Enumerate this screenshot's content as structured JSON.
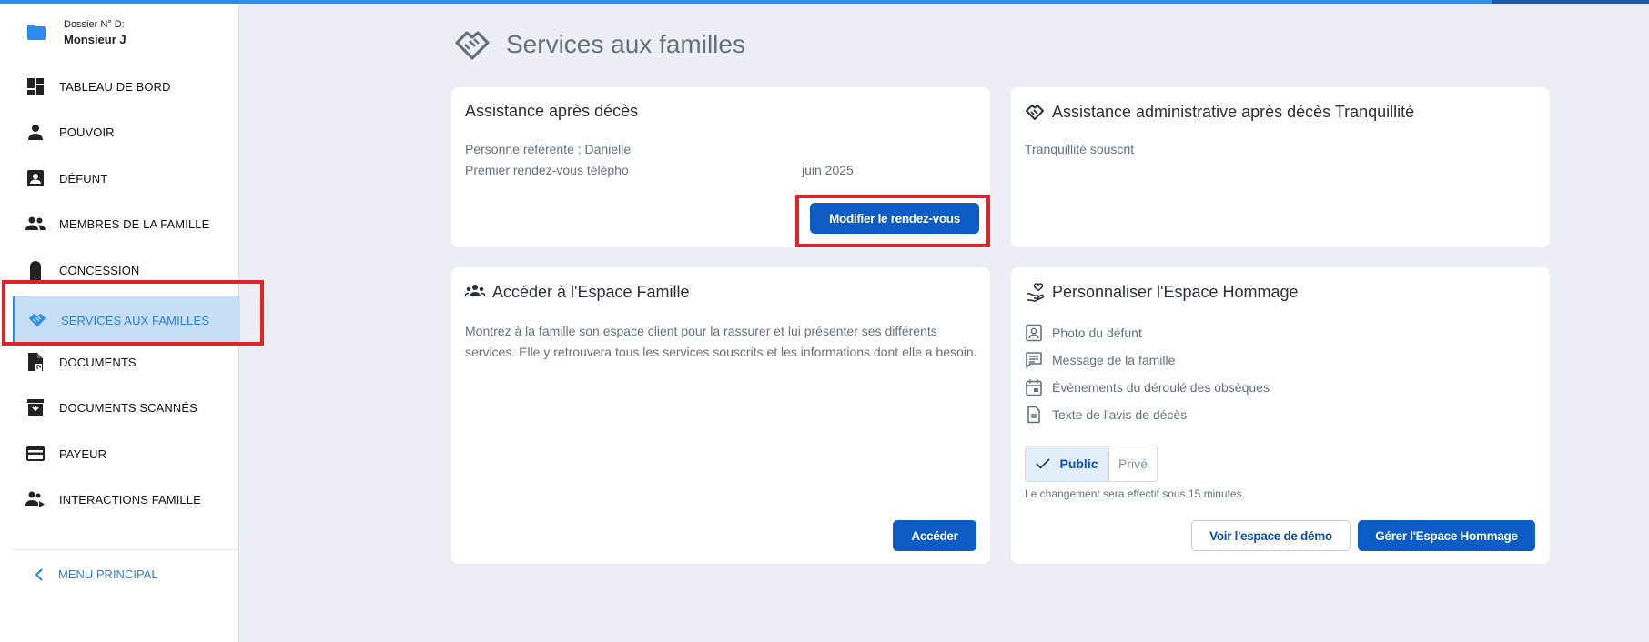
{
  "sidebar": {
    "folder": {
      "number": "Dossier N° D:",
      "name": "Monsieur J"
    },
    "items": [
      {
        "label": "TABLEAU DE BORD",
        "icon": "dashboard-icon"
      },
      {
        "label": "POUVOIR",
        "icon": "person-icon"
      },
      {
        "label": "DÉFUNT",
        "icon": "contact-card-icon"
      },
      {
        "label": "MEMBRES DE LA FAMILLE",
        "icon": "people-icon"
      },
      {
        "label": "CONCESSION",
        "icon": "tombstone-icon"
      },
      {
        "label": "SERVICES AUX FAMILLES",
        "icon": "handshake-icon",
        "active": true
      },
      {
        "label": "DOCUMENTS",
        "icon": "document-icon"
      },
      {
        "label": "DOCUMENTS SCANNÉS",
        "icon": "archive-icon"
      },
      {
        "label": "PAYEUR",
        "icon": "credit-card-icon"
      },
      {
        "label": "INTERACTIONS FAMILLE",
        "icon": "family-interaction-icon"
      }
    ],
    "back_label": "MENU PRINCIPAL"
  },
  "page": {
    "title": "Services aux familles",
    "title_icon": "handshake-icon"
  },
  "cards": {
    "assistance": {
      "title": "Assistance après décès",
      "referent": "Personne référente : Danielle",
      "appointment_prefix": "Premier rendez-vous télépho",
      "appointment_suffix": "juin 2025",
      "button": "Modifier le rendez-vous"
    },
    "admin": {
      "title": "Assistance administrative après décès Tranquillité",
      "status": "Tranquillité souscrit"
    },
    "famille": {
      "title": "Accéder à l'Espace Famille",
      "description": "Montrez à la famille son espace client pour la rassurer et lui présenter ses différents services. Elle y retrouvera tous les services souscrits et les informations dont elle a besoin.",
      "button": "Accéder"
    },
    "hommage": {
      "title": "Personnaliser l'Espace Hommage",
      "features": [
        {
          "label": "Photo du défunt",
          "icon": "portrait-icon"
        },
        {
          "label": "Message de la famille",
          "icon": "message-icon"
        },
        {
          "label": "Évènements du déroulé des obsèques",
          "icon": "calendar-icon"
        },
        {
          "label": "Texte de l'avis de décès",
          "icon": "file-text-icon"
        }
      ],
      "toggle": {
        "public": "Public",
        "prive": "Privé",
        "selected": "Public"
      },
      "note": "Le changement sera effectif sous 15 minutes.",
      "demo_button": "Voir l'espace de démo",
      "manage_button": "Gérer l'Espace Hommage"
    }
  }
}
